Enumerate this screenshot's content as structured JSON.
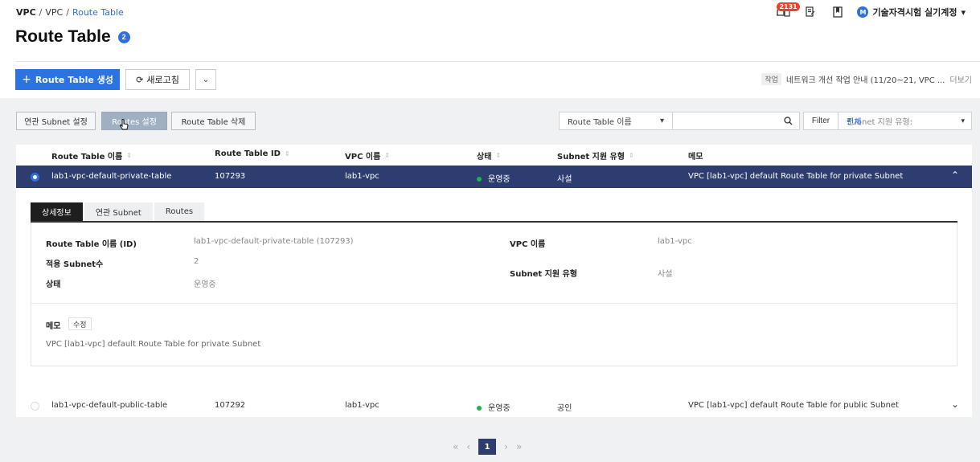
{
  "breadcrumb": {
    "root": "VPC",
    "sep": "/",
    "parent": "VPC",
    "current": "Route Table"
  },
  "page": {
    "title": "Route Table",
    "count_badge": "2"
  },
  "header": {
    "notification_count": "2131",
    "account_initial": "M",
    "account_name": "기술자격시험 실기계정",
    "account_caret": "▾"
  },
  "actions": {
    "create_label": "Route Table 생성",
    "create_icon": "+",
    "refresh_label": "새로고침",
    "refresh_icon": "⟳",
    "more_icon": "⌄"
  },
  "notice": {
    "tag": "작업",
    "text": "네트워크 개선 작업 안내 (11/20~21, VPC ...",
    "more": "더보기"
  },
  "toolbar": {
    "subnet_assoc": "연관 Subnet 설정",
    "routes_setting": "Routes 설정",
    "delete": "Route Table 삭제"
  },
  "filter": {
    "select_label": "Route Table 이름",
    "select_caret": "▾",
    "search_icon": "🔍",
    "filter_button": "Filter",
    "subnet_type_label": "Subnet 지원 유형:",
    "subnet_type_check": "✓",
    "subnet_type_value": "전체",
    "subnet_type_caret": "▾"
  },
  "table": {
    "sort_icon": "⇕",
    "columns": [
      "Route Table 이름",
      "Route Table ID",
      "VPC 이름",
      "상태",
      "Subnet 지원 유형",
      "메모"
    ],
    "rows": [
      {
        "name": "lab1-vpc-default-private-table",
        "id": "107293",
        "vpc": "lab1-vpc",
        "status": "운영중",
        "subnet_type": "사설",
        "memo": "VPC [lab1-vpc] default Route Table for private Subnet",
        "toggle": "⌃"
      },
      {
        "name": "lab1-vpc-default-public-table",
        "id": "107292",
        "vpc": "lab1-vpc",
        "status": "운영중",
        "subnet_type": "공인",
        "memo": "VPC [lab1-vpc] default Route Table for public Subnet",
        "toggle": "⌄"
      }
    ]
  },
  "detail": {
    "tabs": [
      "상세정보",
      "연관 Subnet",
      "Routes"
    ],
    "fields": {
      "name_id_label": "Route Table 이름 (ID)",
      "name_id_value": "lab1-vpc-default-private-table (107293)",
      "subnet_count_label": "적용 Subnet수",
      "subnet_count_value": "2",
      "status_label": "상태",
      "status_value": "운영중",
      "vpc_label": "VPC 이름",
      "vpc_value": "lab1-vpc",
      "subnet_type_label": "Subnet 지원 유형",
      "subnet_type_value": "사설"
    },
    "memo_label": "메모",
    "memo_edit": "수정",
    "memo_text": "VPC [lab1-vpc] default Route Table for private Subnet"
  },
  "pagination": {
    "first": "«",
    "prev": "‹",
    "current": "1",
    "next": "›",
    "last": "»"
  }
}
